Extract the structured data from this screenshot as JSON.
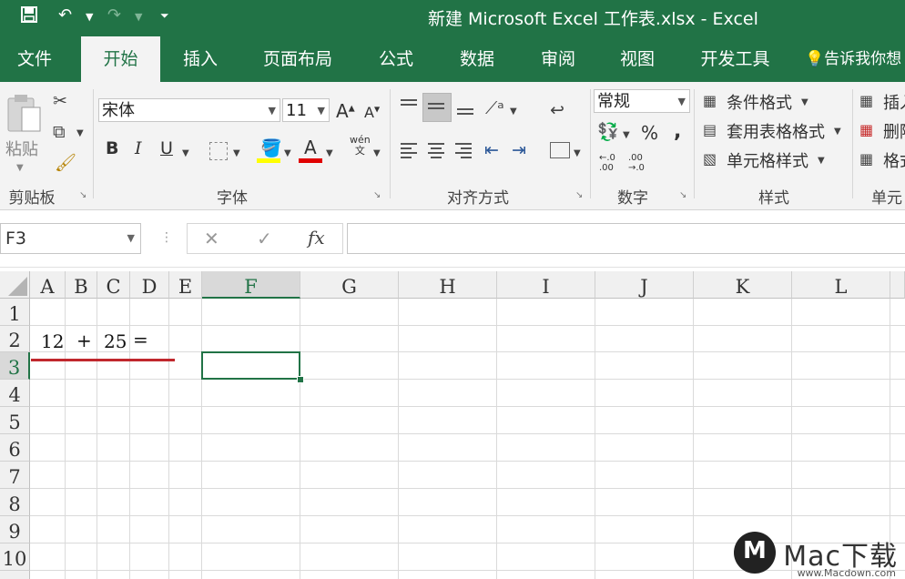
{
  "window": {
    "title": "新建 Microsoft Excel 工作表.xlsx  -  Excel",
    "quick_access": {
      "save_icon": "save-icon",
      "undo_icon": "undo-icon",
      "redo_icon": "redo-icon",
      "customize_icon": "customize-icon"
    }
  },
  "tabs": [
    {
      "label": "文件"
    },
    {
      "label": "开始"
    },
    {
      "label": "插入"
    },
    {
      "label": "页面布局"
    },
    {
      "label": "公式"
    },
    {
      "label": "数据"
    },
    {
      "label": "审阅"
    },
    {
      "label": "视图"
    },
    {
      "label": "开发工具"
    }
  ],
  "active_tab": "开始",
  "tell_me": "告诉我你想",
  "ribbon": {
    "clipboard": {
      "label": "剪贴板",
      "paste": "粘贴"
    },
    "font": {
      "label": "字体",
      "name": "宋体",
      "size": "11",
      "phonetic": "wén\n文",
      "bold": "B",
      "italic": "I",
      "underline": "U",
      "fill_color": "#ffff00",
      "font_color": "#e00000"
    },
    "alignment": {
      "label": "对齐方式"
    },
    "number": {
      "label": "数字",
      "format": "常规",
      "percent": "%",
      "comma": ",",
      "inc_decimal": "←.0\n.00",
      "dec_decimal": ".00\n→.0"
    },
    "styles": {
      "label": "样式",
      "conditional": "条件格式",
      "table": "套用表格格式",
      "cell": "单元格样式"
    },
    "cells": {
      "label": "单元",
      "insert": "插入",
      "delete": "删除",
      "format": "格式"
    }
  },
  "formula_bar": {
    "name_box": "F3",
    "cancel": "✕",
    "enter": "✓",
    "fx": "fx",
    "value": ""
  },
  "sheet": {
    "columns": [
      "A",
      "B",
      "C",
      "D",
      "E",
      "F",
      "G",
      "H",
      "I",
      "J",
      "K",
      "L"
    ],
    "rows": [
      "1",
      "2",
      "3",
      "4",
      "5",
      "6",
      "7",
      "8",
      "9",
      "10"
    ],
    "selected_cell": "F3",
    "cells": {
      "A2": "12",
      "B2": "+",
      "C2": "25",
      "D2": "="
    },
    "accent": "#217346",
    "annotation_color": "#c0272d"
  },
  "watermark": {
    "brand": "Mac下载",
    "url": "www.Macdown.com"
  }
}
